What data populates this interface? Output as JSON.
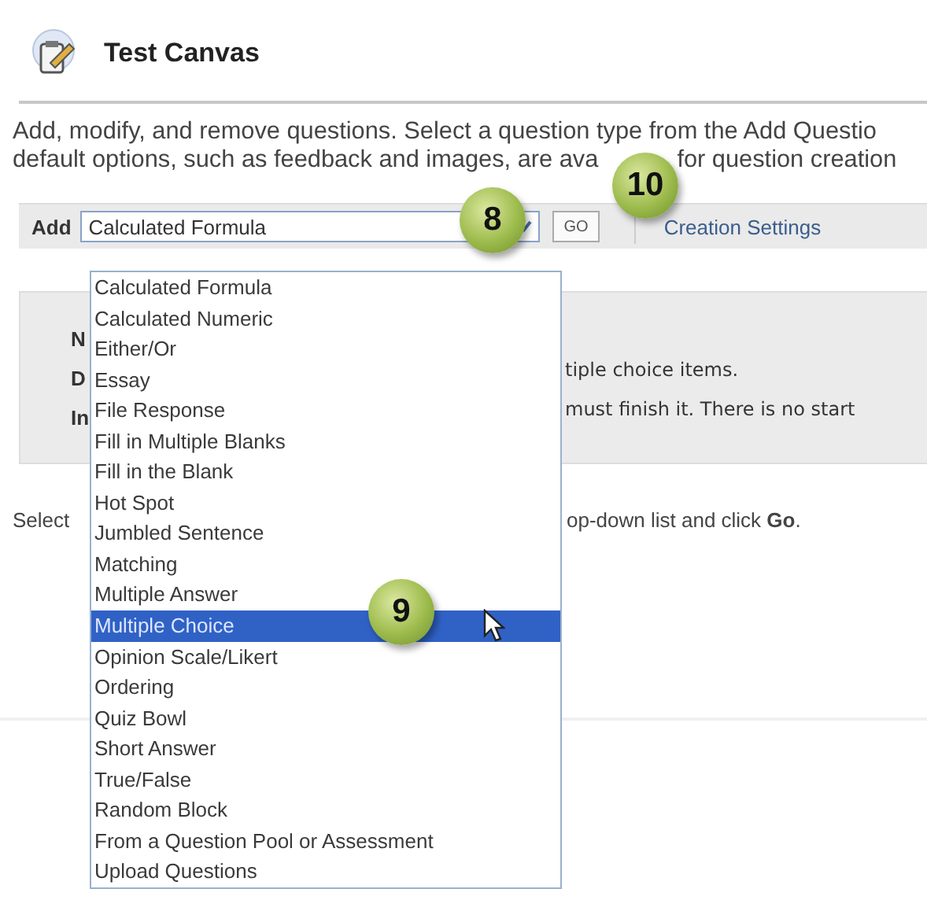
{
  "page": {
    "title": "Test Canvas"
  },
  "description": {
    "line_1": "Add, modify, and remove questions. Select a question type from the Add Questio",
    "line_2_start": "default options, such as feedback and images, are ava",
    "line_2_end": "for question creation"
  },
  "toolbar": {
    "label": "Add",
    "select_value": "Calculated Formula",
    "go_button": "GO",
    "settings_link": "Creation Settings"
  },
  "dropdown": {
    "expanded": true,
    "options": [
      {
        "label": "Calculated Formula",
        "selected": false
      },
      {
        "label": "Calculated Numeric",
        "selected": false
      },
      {
        "label": "Either/Or",
        "selected": false
      },
      {
        "label": "Essay",
        "selected": false
      },
      {
        "label": "File Response",
        "selected": false
      },
      {
        "label": "Fill in Multiple Blanks",
        "selected": false
      },
      {
        "label": "Fill in the Blank",
        "selected": false
      },
      {
        "label": "Hot Spot",
        "selected": false
      },
      {
        "label": "Jumbled Sentence",
        "selected": false
      },
      {
        "label": "Matching",
        "selected": false
      },
      {
        "label": "Multiple Answer",
        "selected": false
      },
      {
        "label": "Multiple Choice",
        "selected": true
      },
      {
        "label": "Opinion Scale/Likert",
        "selected": false
      },
      {
        "label": "Ordering",
        "selected": false
      },
      {
        "label": "Quiz Bowl",
        "selected": false
      },
      {
        "label": "Short Answer",
        "selected": false
      },
      {
        "label": "True/False",
        "selected": false
      },
      {
        "label": "Random Block",
        "selected": false
      },
      {
        "label": "From a Question Pool or Assessment",
        "selected": false
      },
      {
        "label": "Upload Questions",
        "selected": false
      }
    ]
  },
  "info_panel": {
    "rows": [
      {
        "label": "N"
      },
      {
        "label": "D",
        "text": "tiple choice items."
      },
      {
        "label": "In",
        "text": "must finish it. There is no start"
      }
    ]
  },
  "instructions": {
    "start": "Select",
    "end": "op-down list and click **Go**."
  },
  "callouts": [
    {
      "number": "8"
    },
    {
      "number": "10"
    },
    {
      "number": "9"
    }
  ]
}
